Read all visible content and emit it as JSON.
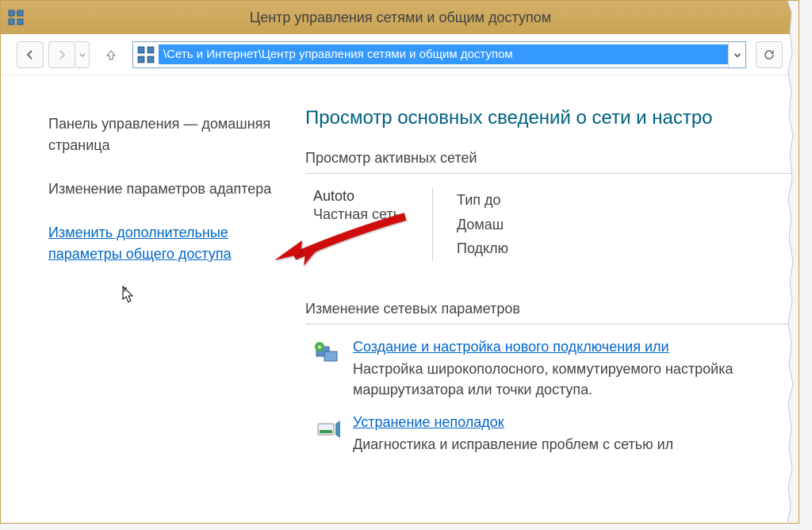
{
  "window": {
    "title": "Центр управления сетями и общим доступом"
  },
  "nav": {
    "address": "\\Сеть и Интернет\\Центр управления сетями и общим доступом"
  },
  "sidebar": {
    "home_link": "Панель управления — домашняя страница",
    "adapter_link": "Изменение параметров адаптера",
    "advanced_link": "Изменить дополнительные параметры общего доступа"
  },
  "main": {
    "title": "Просмотр основных сведений о сети и настро",
    "section_active": "Просмотр активных сетей",
    "network": {
      "name": "Autoto",
      "type": "Частная сеть",
      "right_label1": "Тип до",
      "right_value1": "Домаш",
      "right_label2": "Подклю"
    },
    "section_change": "Изменение сетевых параметров",
    "item1": {
      "link": "Создание и настройка нового подключения или",
      "desc": "Настройка широкополосного, коммутируемого настройка маршрутизатора или точки доступа."
    },
    "item2": {
      "link": "Устранение неполадок",
      "desc": "Диагностика и исправление проблем с сетью ил"
    }
  }
}
